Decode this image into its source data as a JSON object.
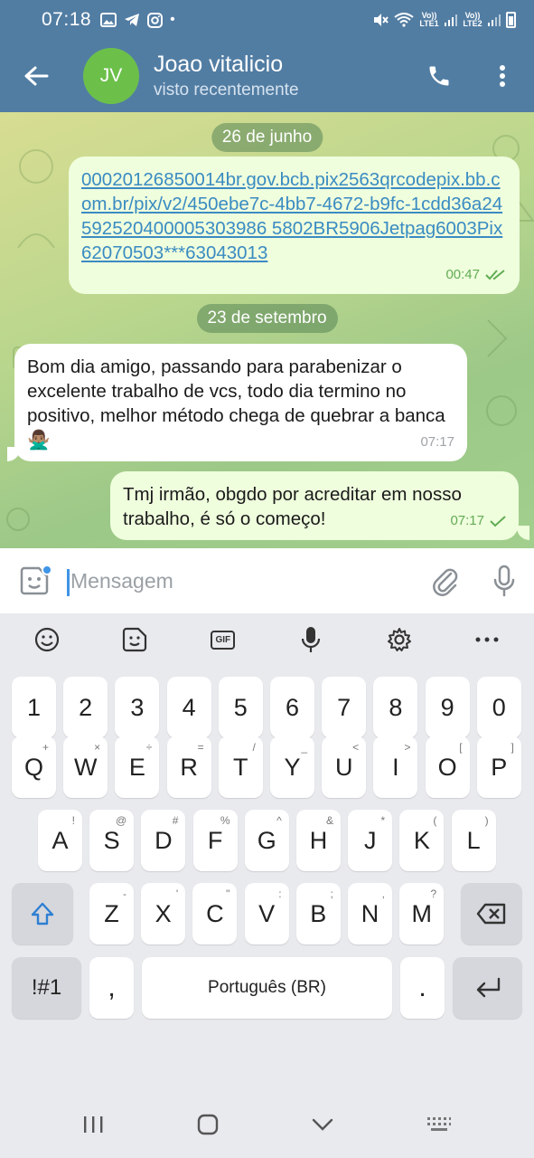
{
  "status_bar": {
    "time": "07:18",
    "left_icons": [
      "gallery-icon",
      "telegram-icon",
      "instagram-icon",
      "dot"
    ],
    "lte1": "Vo)) LTE1",
    "lte2": "Vo)) LTE2"
  },
  "header": {
    "avatar_initials": "JV",
    "title": "Joao vitalicio",
    "subtitle": "visto recentemente",
    "avatar_color": "#6cc04a",
    "bar_color": "#527da3"
  },
  "chat": {
    "date1": "26 de junho",
    "msg1_text": "00020126850014br.gov.bcb.pix2563qrcodepix.bb.com.br/pix/v2/450ebe7c-4bb7-4672-b9fc-1cdd36a24592520400005303986 5802BR5906Jetpag6003Pix62070503***63043013",
    "msg1_time": "00:47",
    "date2": "23 de setembro",
    "msg2_text": "Bom dia amigo, passando para parabenizar o excelente trabalho de vcs, todo dia termino no positivo, melhor método chega de quebrar a banca 🙅🏽‍♂️",
    "msg2_time": "07:17",
    "msg3_text": "Tmj irmão, obgdo por acreditar em nosso trabalho, é só o começo!",
    "msg3_time": "07:17"
  },
  "input": {
    "placeholder": "Mensagem"
  },
  "keyboard": {
    "numbers": [
      "1",
      "2",
      "3",
      "4",
      "5",
      "6",
      "7",
      "8",
      "9",
      "0"
    ],
    "row1": [
      "Q",
      "W",
      "E",
      "R",
      "T",
      "Y",
      "U",
      "I",
      "O",
      "P"
    ],
    "row1_hints": [
      "+",
      "×",
      "÷",
      "=",
      "/",
      "_",
      "<",
      ">",
      "[",
      "]"
    ],
    "row2": [
      "A",
      "S",
      "D",
      "F",
      "G",
      "H",
      "J",
      "K",
      "L"
    ],
    "row2_hints": [
      "!",
      "@",
      "#",
      "%",
      "^",
      "&",
      "*",
      "(",
      ")"
    ],
    "row3": [
      "Z",
      "X",
      "C",
      "V",
      "B",
      "N",
      "M"
    ],
    "row3_hints": [
      "-",
      "'",
      "\"",
      ":",
      ";",
      ",",
      "?"
    ],
    "symbols_label": "!#1",
    "comma_label": ",",
    "space_label": "Português (BR)",
    "period_label": ".",
    "gif_label": "GIF"
  }
}
